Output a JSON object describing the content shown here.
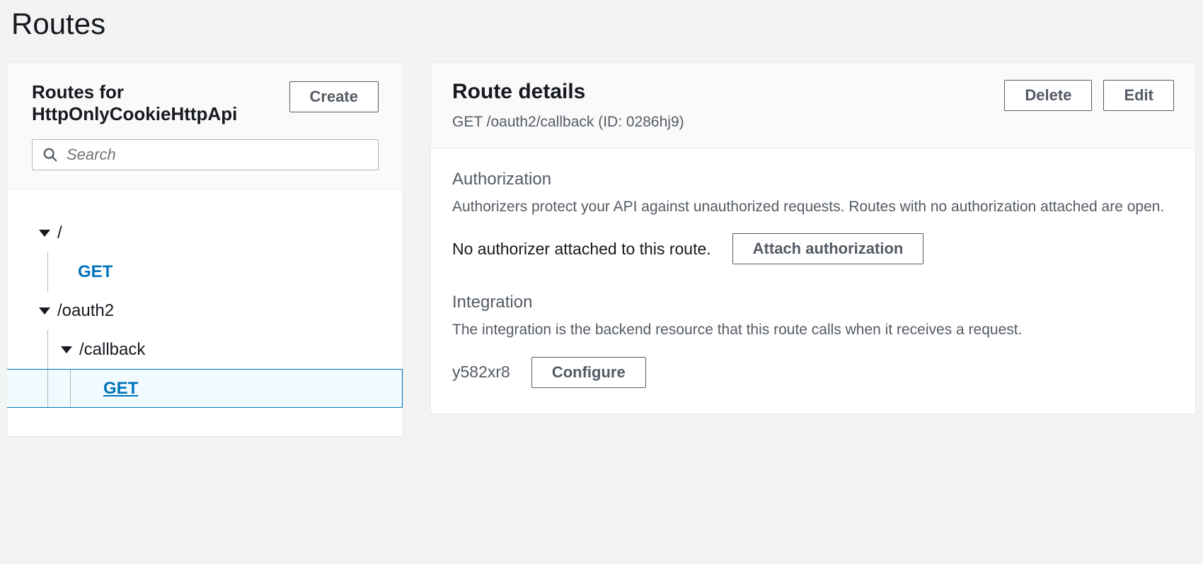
{
  "page": {
    "title": "Routes"
  },
  "left": {
    "heading": "Routes for HttpOnlyCookieHttpApi",
    "create_label": "Create",
    "search_placeholder": "Search",
    "tree": {
      "root_path": "/",
      "root_method": "GET",
      "level1_path": "/oauth2",
      "level2_path": "/callback",
      "level2_method": "GET"
    }
  },
  "right": {
    "heading": "Route details",
    "delete_label": "Delete",
    "edit_label": "Edit",
    "subtitle": "GET /oauth2/callback (ID: 0286hj9)",
    "authorization": {
      "title": "Authorization",
      "desc": "Authorizers protect your API against unauthorized requests. Routes with no authorization attached are open.",
      "status": "No authorizer attached to this route.",
      "attach_label": "Attach authorization"
    },
    "integration": {
      "title": "Integration",
      "desc": "The integration is the backend resource that this route calls when it receives a request.",
      "id": "y582xr8",
      "configure_label": "Configure"
    }
  }
}
